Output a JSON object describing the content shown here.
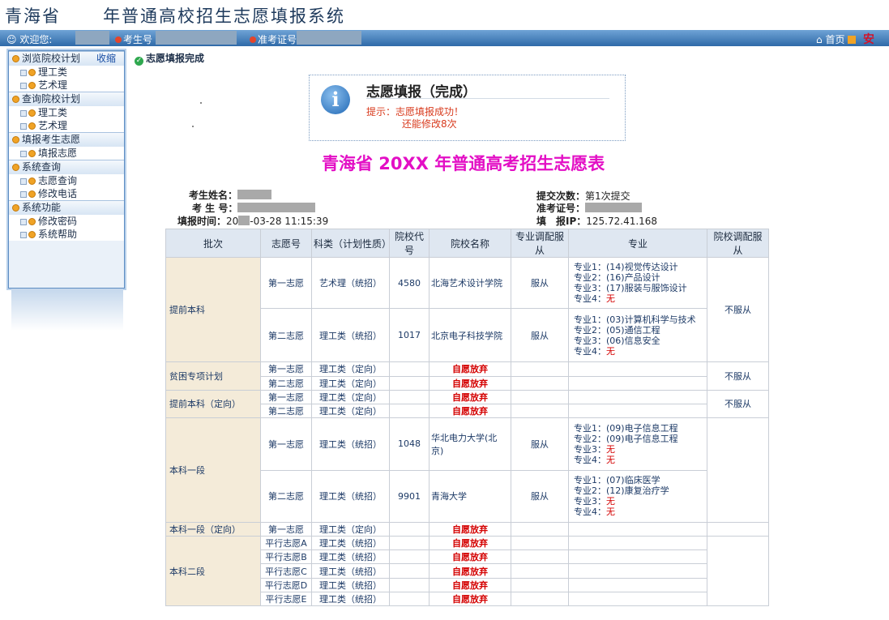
{
  "header": {
    "title_left": "青海省",
    "title_right": "年普通高校招生志愿填报系统"
  },
  "topbar": {
    "welcome": "欢迎您:",
    "exam_no_label": "考生号",
    "ticket_label": "准考证号",
    "home_label": "首页",
    "safe_label": "安"
  },
  "sidebar": {
    "collapse": "收缩",
    "groups": [
      {
        "label": "浏览院校计划",
        "items": [
          "理工类",
          "艺术理"
        ]
      },
      {
        "label": "查询院校计划",
        "items": [
          "理工类",
          "艺术理"
        ]
      },
      {
        "label": "填报考生志愿",
        "items": [
          "填报志愿"
        ]
      },
      {
        "label": "系统查询",
        "items": [
          "志愿查询",
          "修改电话"
        ]
      },
      {
        "label": "系统功能",
        "items": [
          "修改密码",
          "系统帮助"
        ]
      }
    ]
  },
  "status": {
    "done": "志愿填报完成"
  },
  "notice": {
    "heading": "志愿填报（完成）",
    "tip": "提示：志愿填报成功！",
    "remaining": "还能修改8次"
  },
  "page_title": "青海省 20XX 年普通高考招生志愿表",
  "student": {
    "name_label": "考生姓名：",
    "exam_no_label": "考 生 号：",
    "time_label": "填报时间：",
    "time_prefix": "20",
    "time_suffix": "-03-28 11:15:39",
    "submit_label": "提交次数：",
    "submit_value": "第1次提交",
    "ticket_label": "准考证号：",
    "ip_label": "填　报IP：",
    "ip_value": "125.72.41.168"
  },
  "table": {
    "headers": [
      "批次",
      "志愿号",
      "科类（计划性质）",
      "院校代号",
      "院校名称",
      "专业调配服从",
      "专业",
      "院校调配服从"
    ],
    "batches": {
      "b1": "提前本科",
      "b2": "贫困专项计划",
      "b3": "提前本科（定向）",
      "b4": "本科一段",
      "b5": "本科一段（定向）",
      "b6": "本科二段"
    },
    "first": "第一志愿",
    "second": "第二志愿",
    "waive": "自愿放弃",
    "obey": "服从",
    "not_obey": "不服从",
    "cat_art": "艺术理（统招）",
    "cat_sci": "理工类（统招）",
    "cat_dir": "理工类（定向）",
    "none": "无",
    "rows": {
      "r1": {
        "code": "4580",
        "school": "北海艺术设计学院",
        "m1": "专业1：(14)视觉传达设计",
        "m2": "专业2：(16)产品设计",
        "m3": "专业3：(17)服装与服饰设计",
        "m4": "专业4："
      },
      "r2": {
        "code": "1017",
        "school": "北京电子科技学院",
        "m1": "专业1：(03)计算机科学与技术",
        "m2": "专业2：(05)通信工程",
        "m3": "专业3：(06)信息安全",
        "m4": "专业4："
      },
      "r3": {
        "code": "1048",
        "school": "华北电力大学(北京)",
        "m1": "专业1：(09)电子信息工程",
        "m2": "专业2：(09)电子信息工程",
        "m3": "专业3：",
        "m4": "专业4："
      },
      "r4": {
        "code": "9901",
        "school": "青海大学",
        "m1": "专业1：(07)临床医学",
        "m2": "专业2：(12)康复治疗学",
        "m3": "专业3：",
        "m4": "专业4："
      }
    },
    "parallel": [
      "平行志愿A",
      "平行志愿B",
      "平行志愿C",
      "平行志愿D",
      "平行志愿E"
    ]
  }
}
